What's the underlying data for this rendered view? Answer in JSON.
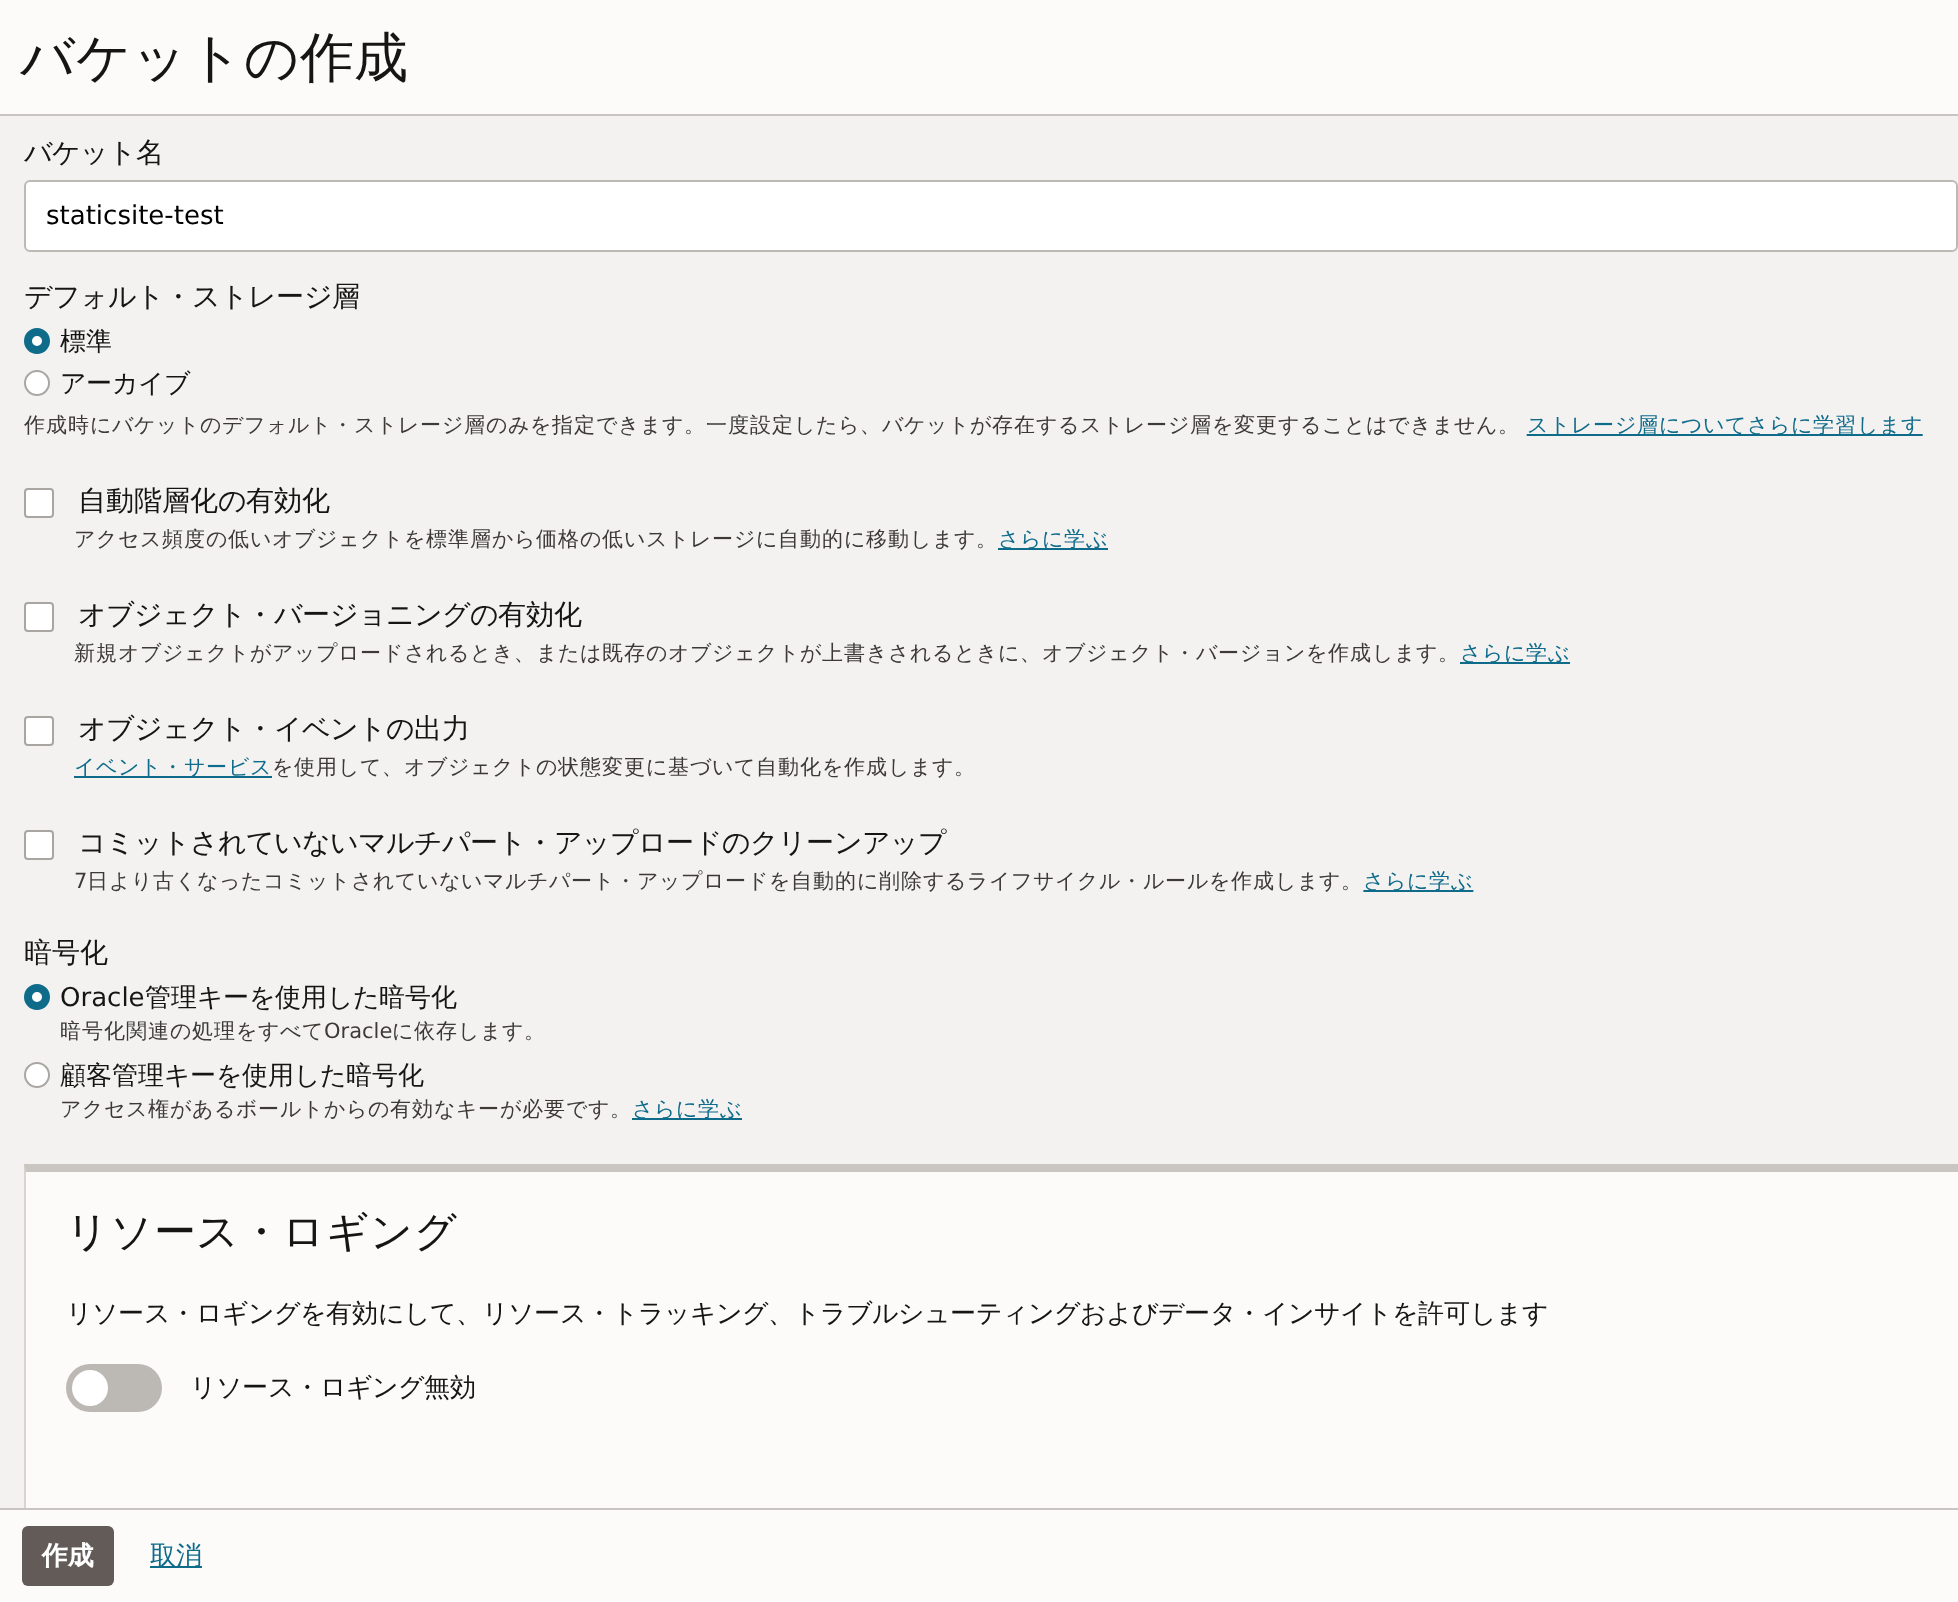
{
  "title": "バケットの作成",
  "bucket_name": {
    "label": "バケット名",
    "value": "staticsite-test"
  },
  "storage_tier": {
    "label": "デフォルト・ストレージ層",
    "options": [
      {
        "label": "標準",
        "selected": true
      },
      {
        "label": "アーカイブ",
        "selected": false
      }
    ],
    "note": [
      {
        "kind": "text",
        "text": "作成時にバケットのデフォルト・ストレージ層のみを指定できます。一度設定したら、バケットが存在するストレージ層を変更することはできません。 "
      },
      {
        "kind": "link",
        "text": "ストレージ層についてさらに学習します"
      }
    ]
  },
  "options": [
    {
      "label": "自動階層化の有効化",
      "checked": false,
      "description": [
        {
          "kind": "text",
          "text": "アクセス頻度の低いオブジェクトを標準層から価格の低いストレージに自動的に移動します。"
        },
        {
          "kind": "link",
          "text": "さらに学ぶ"
        }
      ]
    },
    {
      "label": "オブジェクト・バージョニングの有効化",
      "checked": false,
      "description": [
        {
          "kind": "text",
          "text": "新規オブジェクトがアップロードされるとき、または既存のオブジェクトが上書きされるときに、オブジェクト・バージョンを作成します。"
        },
        {
          "kind": "link",
          "text": "さらに学ぶ"
        }
      ]
    },
    {
      "label": "オブジェクト・イベントの出力",
      "checked": false,
      "description": [
        {
          "kind": "link",
          "text": "イベント・サービス"
        },
        {
          "kind": "text",
          "text": "を使用して、オブジェクトの状態変更に基づいて自動化を作成します。"
        }
      ]
    },
    {
      "label": "コミットされていないマルチパート・アップロードのクリーンアップ",
      "checked": false,
      "description": [
        {
          "kind": "text",
          "text": "7日より古くなったコミットされていないマルチパート・アップロードを自動的に削除するライフサイクル・ルールを作成します。"
        },
        {
          "kind": "link",
          "text": "さらに学ぶ"
        }
      ]
    }
  ],
  "encryption": {
    "label": "暗号化",
    "options": [
      {
        "label": "Oracle管理キーを使用した暗号化",
        "selected": true,
        "description": [
          {
            "kind": "text",
            "text": "暗号化関連の処理をすべてOracleに依存します。"
          }
        ]
      },
      {
        "label": "顧客管理キーを使用した暗号化",
        "selected": false,
        "description": [
          {
            "kind": "text",
            "text": "アクセス権があるボールトからの有効なキーが必要です。"
          },
          {
            "kind": "link",
            "text": "さらに学ぶ"
          }
        ]
      }
    ]
  },
  "resource_logging": {
    "title": "リソース・ロギング",
    "description": "リソース・ロギングを有効にして、リソース・トラッキング、トラブルシューティングおよびデータ・インサイトを許可します",
    "toggle": {
      "label": "リソース・ロギング無効",
      "on": false
    }
  },
  "buttons": [
    {
      "kind": "primary",
      "label": "作成"
    },
    {
      "kind": "link",
      "label": "取消"
    }
  ]
}
